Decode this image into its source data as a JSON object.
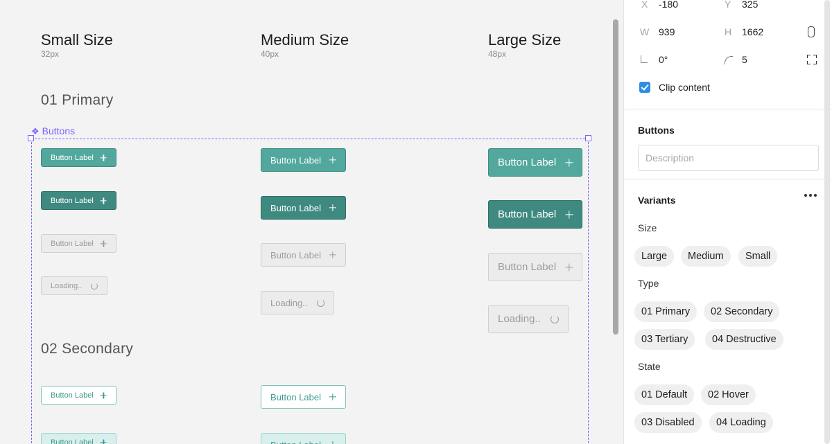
{
  "canvas": {
    "columns": [
      {
        "title": "Small Size",
        "sub": "32px"
      },
      {
        "title": "Medium Size",
        "sub": "40px"
      },
      {
        "title": "Large Size",
        "sub": "48px"
      }
    ],
    "sections": [
      "01 Primary",
      "02 Secondary"
    ],
    "component_name": "Buttons",
    "button_label": "Button Label",
    "loading_label": "Loading.."
  },
  "panel": {
    "position": {
      "x_key": "X",
      "x": "-180",
      "y_key": "Y",
      "y": "325"
    },
    "size": {
      "w_key": "W",
      "w": "939",
      "h_key": "H",
      "h": "1662"
    },
    "rotation": "0°",
    "radius": "5",
    "clip_content": "Clip content",
    "component_title": "Buttons",
    "description_placeholder": "Description",
    "variants_title": "Variants",
    "size_label": "Size",
    "size_options": [
      "Large",
      "Medium",
      "Small"
    ],
    "type_label": "Type",
    "type_options": [
      "01 Primary",
      "02 Secondary",
      "03 Tertiary",
      "04 Destructive"
    ],
    "state_label": "State",
    "state_options": [
      "01 Default",
      "02 Hover",
      "03 Disabled",
      "04 Loading"
    ]
  },
  "colors": {
    "primary": "#52a89d",
    "primary_hover": "#3f8a80",
    "selection": "#7b61ff",
    "checkbox": "#2f8de4"
  }
}
